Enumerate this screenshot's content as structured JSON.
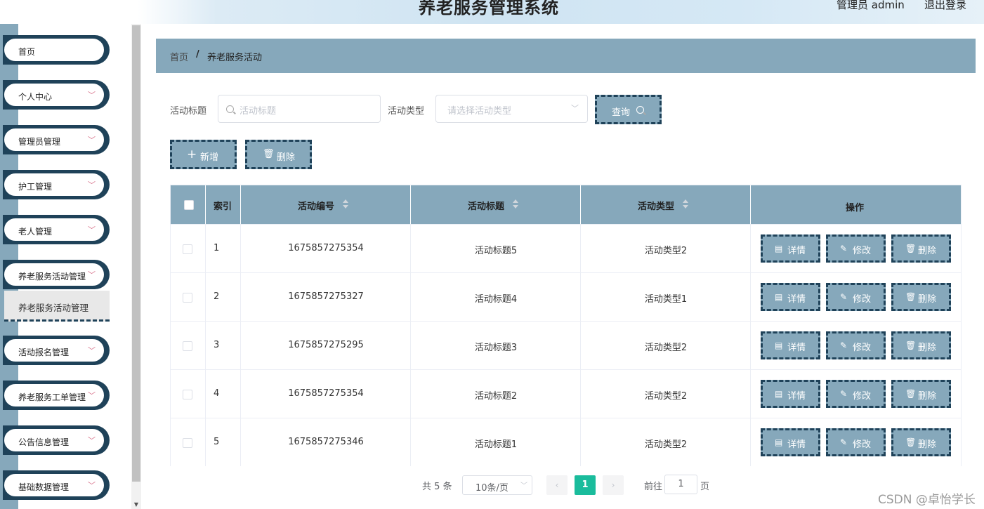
{
  "header": {
    "title": "养老服务管理系统",
    "user_label": "管理员 admin",
    "logout": "退出登录"
  },
  "sidebar": {
    "items": [
      {
        "label": "首页"
      },
      {
        "label": "个人中心"
      },
      {
        "label": "管理员管理"
      },
      {
        "label": "护工管理"
      },
      {
        "label": "老人管理"
      },
      {
        "label": "养老服务活动管理"
      },
      {
        "label": "活动报名管理"
      },
      {
        "label": "养老服务工单管理"
      },
      {
        "label": "公告信息管理"
      },
      {
        "label": "基础数据管理"
      }
    ],
    "active_sub": "养老服务活动管理"
  },
  "breadcrumb": {
    "home": "首页",
    "separator": "/",
    "current": "养老服务活动"
  },
  "filters": {
    "title_label": "活动标题",
    "title_placeholder": "活动标题",
    "type_label": "活动类型",
    "type_placeholder": "请选择活动类型",
    "search_button": "查询"
  },
  "actions": {
    "add": "新增",
    "delete": "删除"
  },
  "table": {
    "columns": [
      "索引",
      "活动编号",
      "活动标题",
      "活动类型",
      "操作"
    ],
    "rows": [
      {
        "index": "1",
        "code": "1675857275354",
        "title": "活动标题5",
        "type": "活动类型2"
      },
      {
        "index": "2",
        "code": "1675857275327",
        "title": "活动标题4",
        "type": "活动类型1"
      },
      {
        "index": "3",
        "code": "1675857275295",
        "title": "活动标题3",
        "type": "活动类型2"
      },
      {
        "index": "4",
        "code": "1675857275354",
        "title": "活动标题2",
        "type": "活动类型2"
      },
      {
        "index": "5",
        "code": "1675857275346",
        "title": "活动标题1",
        "type": "活动类型2"
      }
    ],
    "row_actions": {
      "detail": "详情",
      "edit": "修改",
      "delete": "删除"
    }
  },
  "pagination": {
    "total": "共 5 条",
    "page_size": "10条/页",
    "current_page": "1",
    "goto_label": "前往",
    "goto_value": "1",
    "page_suffix": "页"
  },
  "watermark": "CSDN @卓怡学长",
  "colors": {
    "primary": "#86a8bb",
    "dark": "#1f4259",
    "active_page": "#1abc9c"
  }
}
